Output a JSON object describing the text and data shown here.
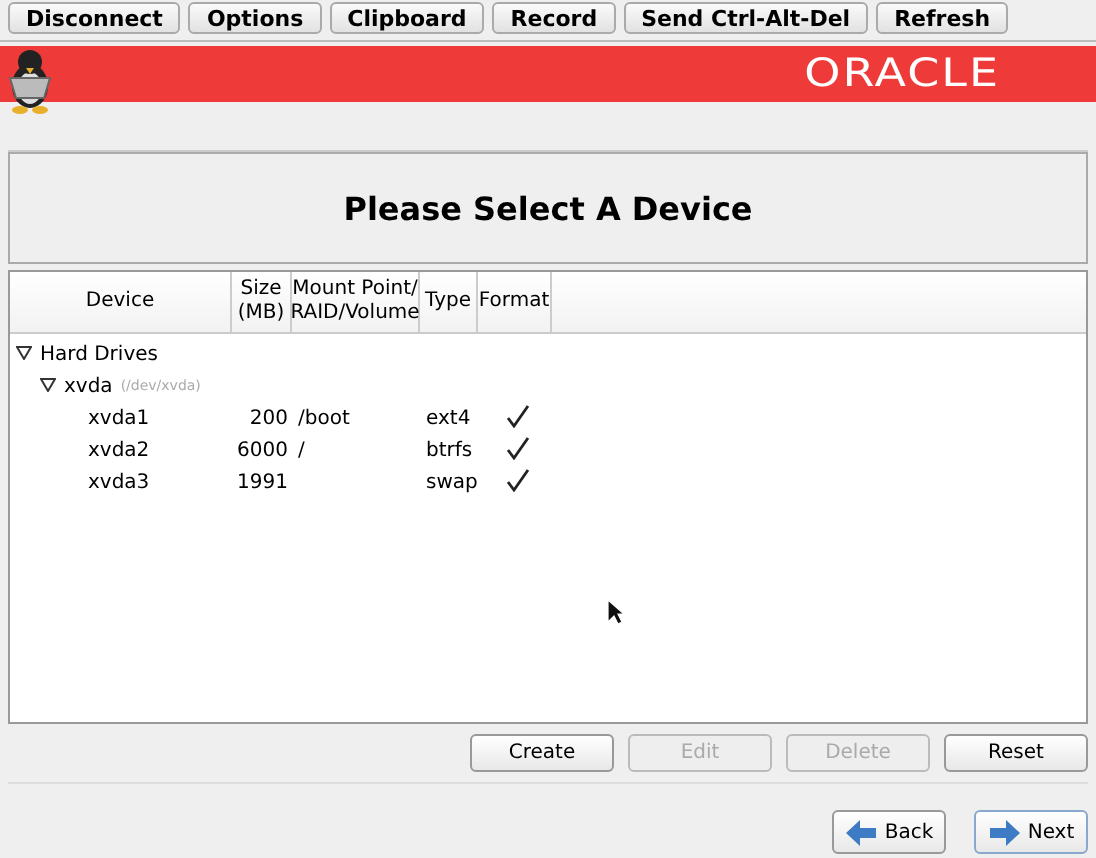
{
  "toolbar": [
    {
      "label": "Disconnect"
    },
    {
      "label": "Options"
    },
    {
      "label": "Clipboard"
    },
    {
      "label": "Record"
    },
    {
      "label": "Send Ctrl-Alt-Del"
    },
    {
      "label": "Refresh"
    }
  ],
  "banner": {
    "logo": "ORACLE"
  },
  "title": "Please Select A Device",
  "table": {
    "columns": [
      "Device",
      "Size\n(MB)",
      "Mount Point/\nRAID/Volume",
      "Type",
      "Format"
    ],
    "tree": [
      {
        "device": "Hard Drives",
        "expanded": true,
        "children": [
          {
            "device": "xvda",
            "path": "(/dev/xvda)",
            "expanded": true,
            "children": [
              {
                "device": "xvda1",
                "size": "200",
                "mount": "/boot",
                "type": "ext4",
                "format": true
              },
              {
                "device": "xvda2",
                "size": "6000",
                "mount": "/",
                "type": "btrfs",
                "format": true
              },
              {
                "device": "xvda3",
                "size": "1991",
                "type": "swap",
                "format": true
              }
            ]
          }
        ]
      }
    ]
  },
  "actions": [
    {
      "label": "Create",
      "disabled": false
    },
    {
      "label": "Edit",
      "disabled": true
    },
    {
      "label": "Delete",
      "disabled": true
    },
    {
      "label": "Reset",
      "disabled": false
    }
  ],
  "nav": [
    {
      "label": "Back",
      "kind": "back"
    },
    {
      "label": "Next",
      "kind": "next"
    }
  ]
}
